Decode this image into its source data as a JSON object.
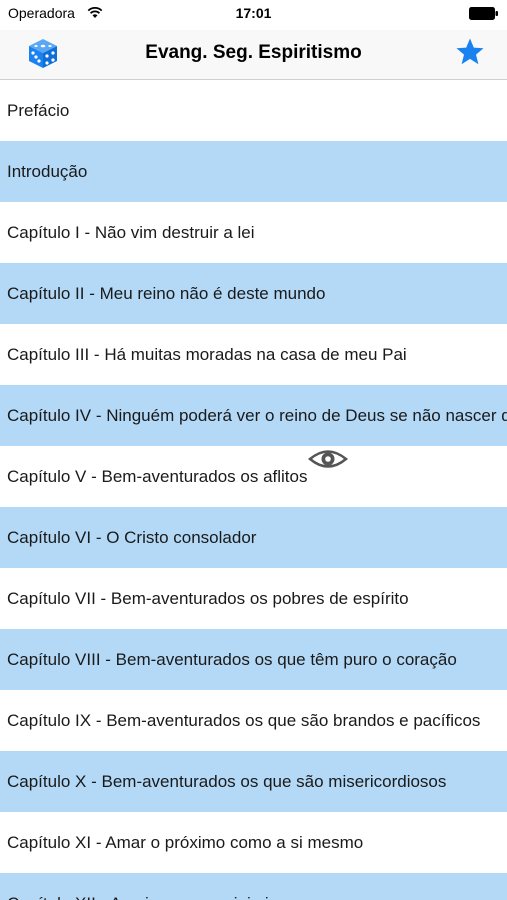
{
  "status_bar": {
    "carrier": "Operadora",
    "time": "17:01"
  },
  "nav": {
    "title": "Evang. Seg. Espiritismo",
    "left_icon": "dice-icon",
    "right_icon": "star-icon"
  },
  "colors": {
    "accent": "#1a82f0",
    "row_highlight": "#b3d9f7",
    "row_plain": "#ffffff"
  },
  "chapters": [
    {
      "label": "Prefácio"
    },
    {
      "label": "Introdução"
    },
    {
      "label": "Capítulo I - Não vim destruir a lei"
    },
    {
      "label": "Capítulo II - Meu reino não é deste mundo"
    },
    {
      "label": "Capítulo III - Há muitas moradas na casa de meu Pai"
    },
    {
      "label": "Capítulo IV - Ninguém poderá ver o reino de Deus se não nascer de novo"
    },
    {
      "label": "Capítulo V - Bem-aventurados os aflitos"
    },
    {
      "label": "Capítulo VI - O Cristo consolador"
    },
    {
      "label": "Capítulo VII - Bem-aventurados os pobres de espírito"
    },
    {
      "label": "Capítulo VIII - Bem-aventurados os que têm puro o coração"
    },
    {
      "label": "Capítulo IX - Bem-aventurados os que são brandos e pacíficos"
    },
    {
      "label": "Capítulo X - Bem-aventurados os que são misericordiosos"
    },
    {
      "label": "Capítulo XI - Amar o próximo como a si mesmo"
    },
    {
      "label": "Capítulo XII - Amai os vossos inimigos"
    }
  ]
}
